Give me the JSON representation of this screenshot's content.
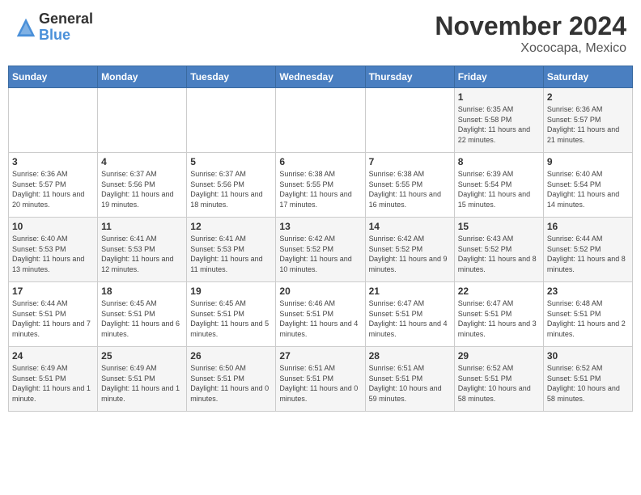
{
  "logo": {
    "general": "General",
    "blue": "Blue"
  },
  "title": "November 2024",
  "location": "Xococapa, Mexico",
  "days_of_week": [
    "Sunday",
    "Monday",
    "Tuesday",
    "Wednesday",
    "Thursday",
    "Friday",
    "Saturday"
  ],
  "weeks": [
    [
      {
        "day": "",
        "info": ""
      },
      {
        "day": "",
        "info": ""
      },
      {
        "day": "",
        "info": ""
      },
      {
        "day": "",
        "info": ""
      },
      {
        "day": "",
        "info": ""
      },
      {
        "day": "1",
        "info": "Sunrise: 6:35 AM\nSunset: 5:58 PM\nDaylight: 11 hours and 22 minutes."
      },
      {
        "day": "2",
        "info": "Sunrise: 6:36 AM\nSunset: 5:57 PM\nDaylight: 11 hours and 21 minutes."
      }
    ],
    [
      {
        "day": "3",
        "info": "Sunrise: 6:36 AM\nSunset: 5:57 PM\nDaylight: 11 hours and 20 minutes."
      },
      {
        "day": "4",
        "info": "Sunrise: 6:37 AM\nSunset: 5:56 PM\nDaylight: 11 hours and 19 minutes."
      },
      {
        "day": "5",
        "info": "Sunrise: 6:37 AM\nSunset: 5:56 PM\nDaylight: 11 hours and 18 minutes."
      },
      {
        "day": "6",
        "info": "Sunrise: 6:38 AM\nSunset: 5:55 PM\nDaylight: 11 hours and 17 minutes."
      },
      {
        "day": "7",
        "info": "Sunrise: 6:38 AM\nSunset: 5:55 PM\nDaylight: 11 hours and 16 minutes."
      },
      {
        "day": "8",
        "info": "Sunrise: 6:39 AM\nSunset: 5:54 PM\nDaylight: 11 hours and 15 minutes."
      },
      {
        "day": "9",
        "info": "Sunrise: 6:40 AM\nSunset: 5:54 PM\nDaylight: 11 hours and 14 minutes."
      }
    ],
    [
      {
        "day": "10",
        "info": "Sunrise: 6:40 AM\nSunset: 5:53 PM\nDaylight: 11 hours and 13 minutes."
      },
      {
        "day": "11",
        "info": "Sunrise: 6:41 AM\nSunset: 5:53 PM\nDaylight: 11 hours and 12 minutes."
      },
      {
        "day": "12",
        "info": "Sunrise: 6:41 AM\nSunset: 5:53 PM\nDaylight: 11 hours and 11 minutes."
      },
      {
        "day": "13",
        "info": "Sunrise: 6:42 AM\nSunset: 5:52 PM\nDaylight: 11 hours and 10 minutes."
      },
      {
        "day": "14",
        "info": "Sunrise: 6:42 AM\nSunset: 5:52 PM\nDaylight: 11 hours and 9 minutes."
      },
      {
        "day": "15",
        "info": "Sunrise: 6:43 AM\nSunset: 5:52 PM\nDaylight: 11 hours and 8 minutes."
      },
      {
        "day": "16",
        "info": "Sunrise: 6:44 AM\nSunset: 5:52 PM\nDaylight: 11 hours and 8 minutes."
      }
    ],
    [
      {
        "day": "17",
        "info": "Sunrise: 6:44 AM\nSunset: 5:51 PM\nDaylight: 11 hours and 7 minutes."
      },
      {
        "day": "18",
        "info": "Sunrise: 6:45 AM\nSunset: 5:51 PM\nDaylight: 11 hours and 6 minutes."
      },
      {
        "day": "19",
        "info": "Sunrise: 6:45 AM\nSunset: 5:51 PM\nDaylight: 11 hours and 5 minutes."
      },
      {
        "day": "20",
        "info": "Sunrise: 6:46 AM\nSunset: 5:51 PM\nDaylight: 11 hours and 4 minutes."
      },
      {
        "day": "21",
        "info": "Sunrise: 6:47 AM\nSunset: 5:51 PM\nDaylight: 11 hours and 4 minutes."
      },
      {
        "day": "22",
        "info": "Sunrise: 6:47 AM\nSunset: 5:51 PM\nDaylight: 11 hours and 3 minutes."
      },
      {
        "day": "23",
        "info": "Sunrise: 6:48 AM\nSunset: 5:51 PM\nDaylight: 11 hours and 2 minutes."
      }
    ],
    [
      {
        "day": "24",
        "info": "Sunrise: 6:49 AM\nSunset: 5:51 PM\nDaylight: 11 hours and 1 minute."
      },
      {
        "day": "25",
        "info": "Sunrise: 6:49 AM\nSunset: 5:51 PM\nDaylight: 11 hours and 1 minute."
      },
      {
        "day": "26",
        "info": "Sunrise: 6:50 AM\nSunset: 5:51 PM\nDaylight: 11 hours and 0 minutes."
      },
      {
        "day": "27",
        "info": "Sunrise: 6:51 AM\nSunset: 5:51 PM\nDaylight: 11 hours and 0 minutes."
      },
      {
        "day": "28",
        "info": "Sunrise: 6:51 AM\nSunset: 5:51 PM\nDaylight: 10 hours and 59 minutes."
      },
      {
        "day": "29",
        "info": "Sunrise: 6:52 AM\nSunset: 5:51 PM\nDaylight: 10 hours and 58 minutes."
      },
      {
        "day": "30",
        "info": "Sunrise: 6:52 AM\nSunset: 5:51 PM\nDaylight: 10 hours and 58 minutes."
      }
    ]
  ]
}
